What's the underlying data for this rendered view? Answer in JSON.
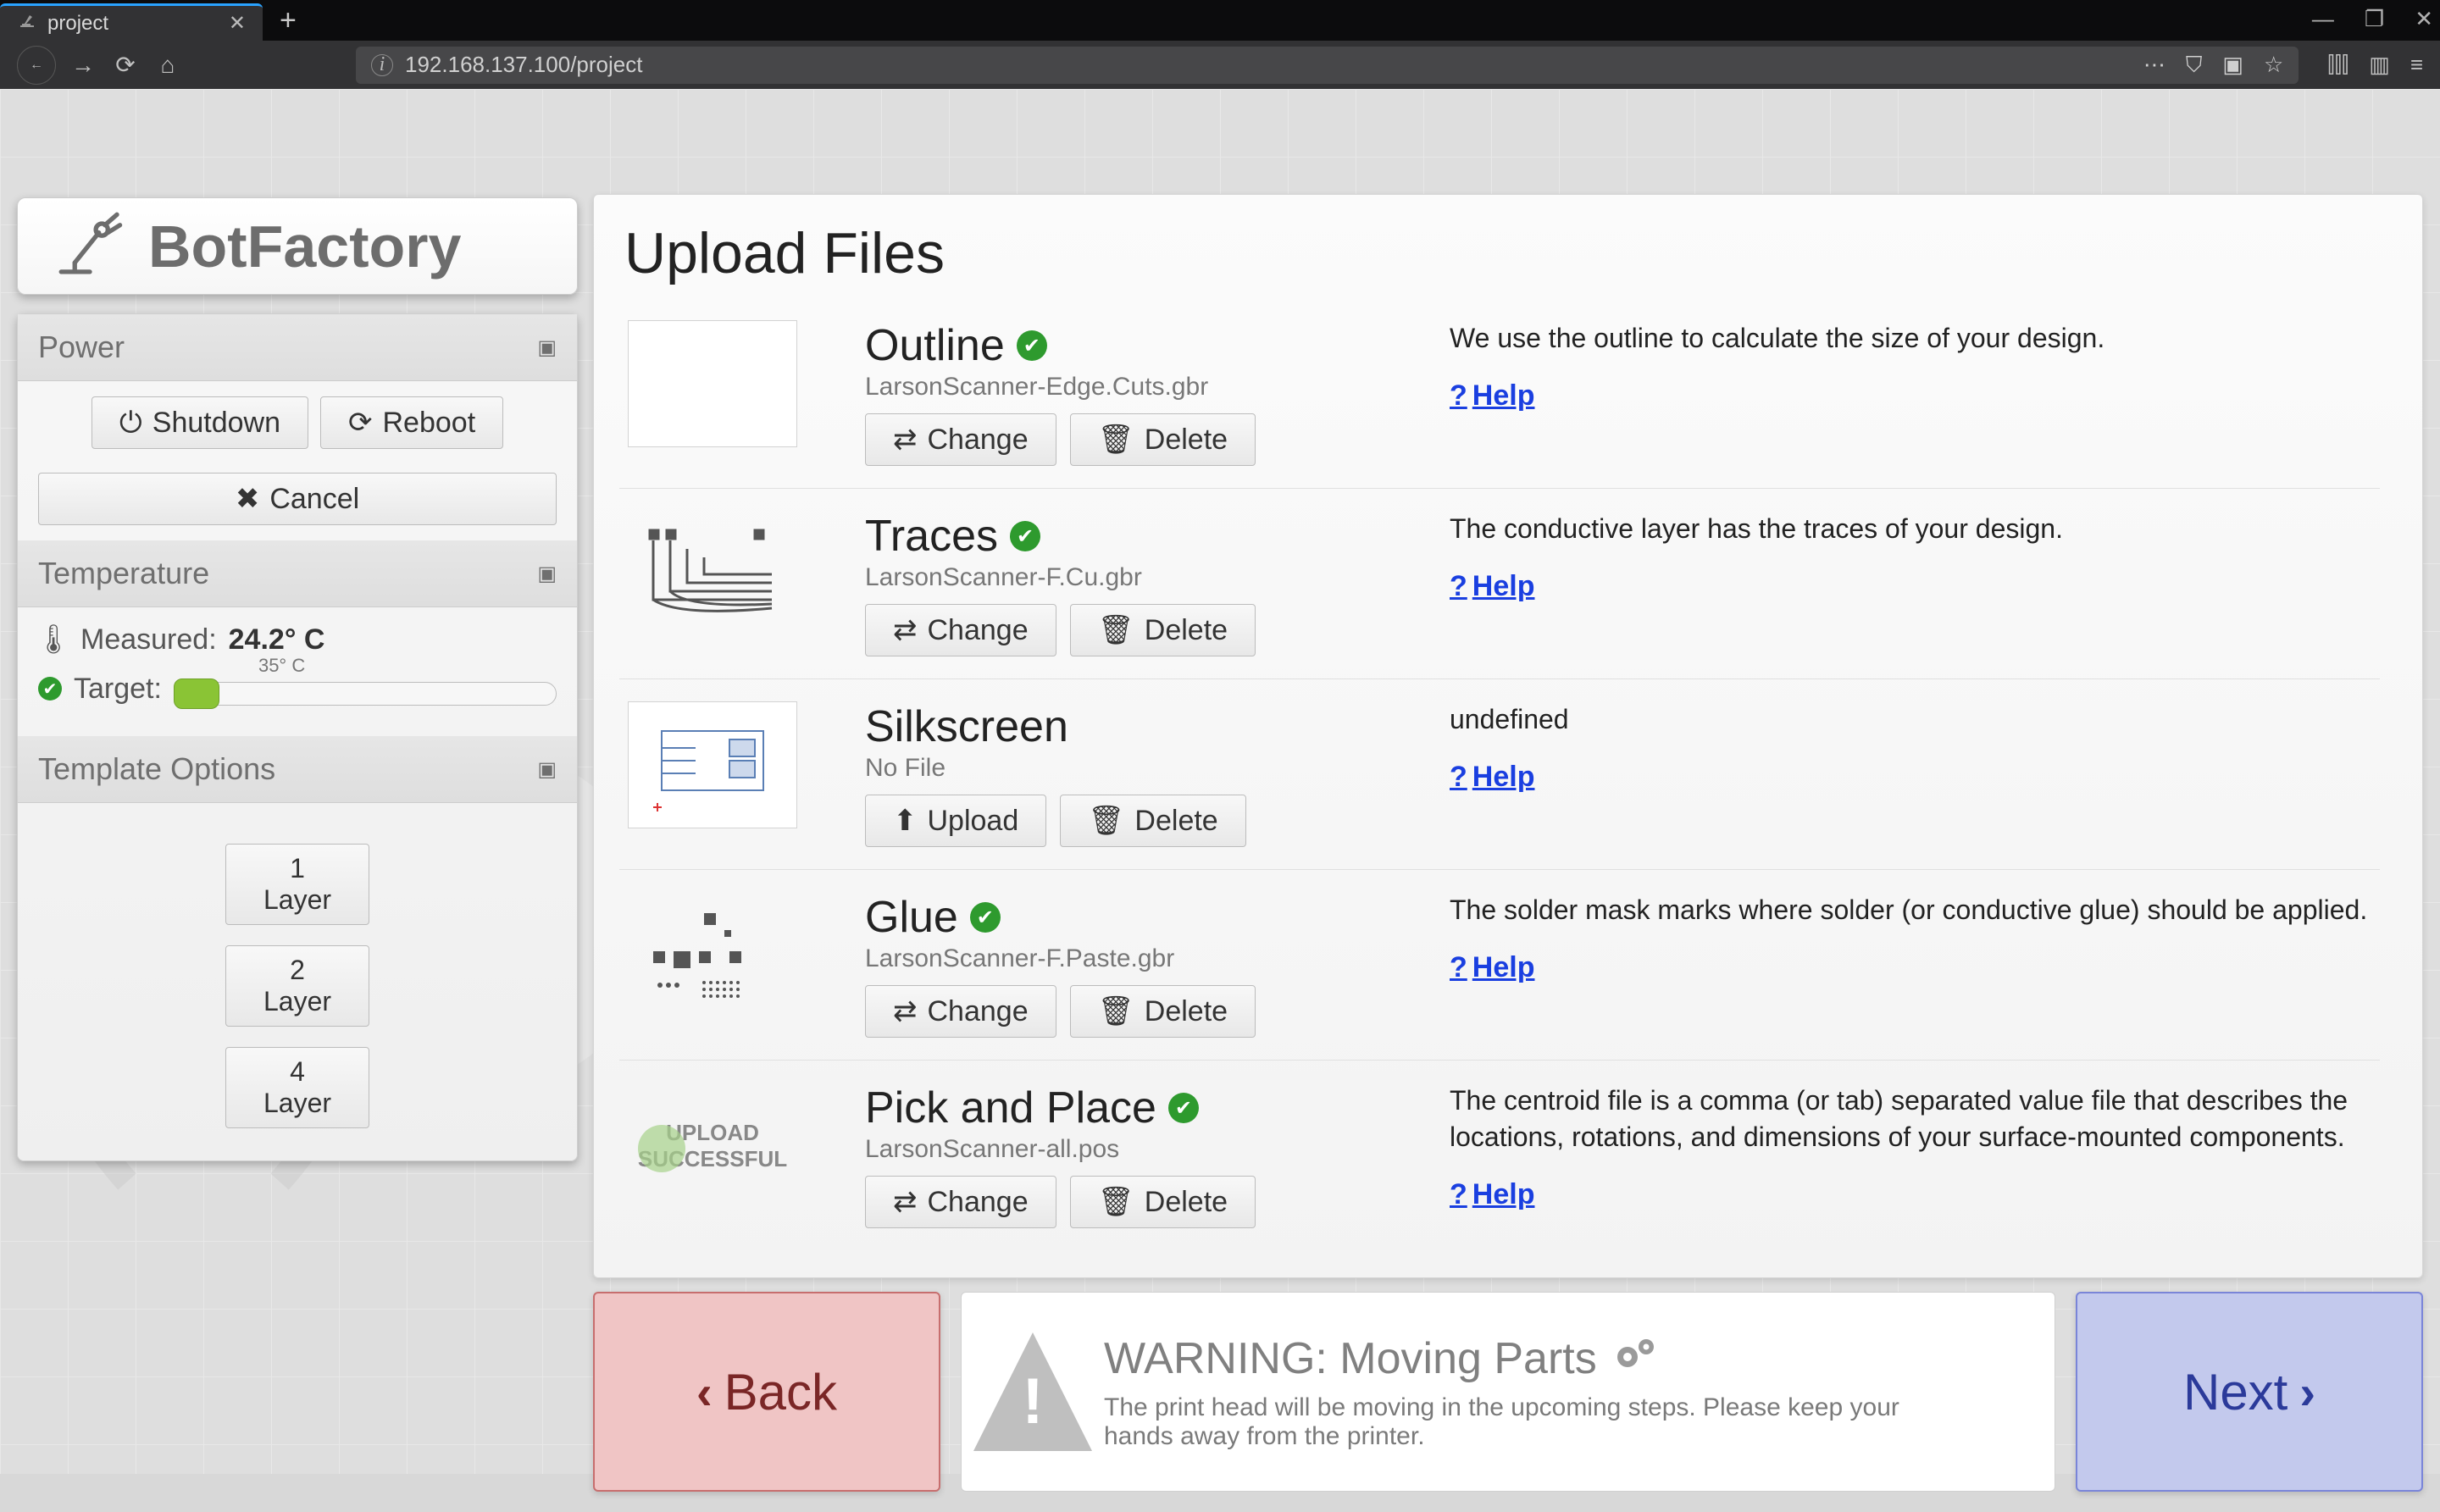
{
  "browser": {
    "tab_title": "project",
    "url": "192.168.137.100/project"
  },
  "brand": "BotFactory",
  "panels": {
    "power": {
      "title": "Power",
      "shutdown": "Shutdown",
      "reboot": "Reboot",
      "cancel": "Cancel"
    },
    "temperature": {
      "title": "Temperature",
      "measured_label": "Measured:",
      "measured_value": "24.2° C",
      "target_label": "Target:",
      "slider_tick": "35° C"
    },
    "template": {
      "title": "Template Options",
      "layer1": "1 Layer",
      "layer2": "2 Layer",
      "layer4": "4 Layer"
    }
  },
  "main": {
    "title": "Upload Files",
    "change": "Change",
    "delete": "Delete",
    "upload": "Upload",
    "help": " Help",
    "files": {
      "outline": {
        "heading": "Outline",
        "filename": "LarsonScanner-Edge.Cuts.gbr",
        "desc": "We use the outline to calculate the size of your design.",
        "ok": true
      },
      "traces": {
        "heading": "Traces",
        "filename": "LarsonScanner-F.Cu.gbr",
        "desc": "The conductive layer has the traces of your design.",
        "ok": true
      },
      "silkscreen": {
        "heading": "Silkscreen",
        "filename": "No File",
        "desc": "undefined",
        "ok": false
      },
      "glue": {
        "heading": "Glue",
        "filename": "LarsonScanner-F.Paste.gbr",
        "desc": "The solder mask marks where solder (or conductive glue) should be applied.",
        "ok": true
      },
      "pnp": {
        "heading": "Pick and Place",
        "filename": "LarsonScanner-all.pos",
        "desc": "The centroid file is a comma (or tab) separated value file that describes the locations, rotations, and dimensions of your surface-mounted components.",
        "ok": true,
        "upload_line1": "UPLOAD",
        "upload_line2": "SUCCESSFUL"
      }
    }
  },
  "wizard": {
    "back": "Back",
    "next": "Next",
    "warning_title": "WARNING: Moving Parts",
    "warning_body": "The print head will be moving in the upcoming steps. Please keep your hands away from the printer."
  }
}
